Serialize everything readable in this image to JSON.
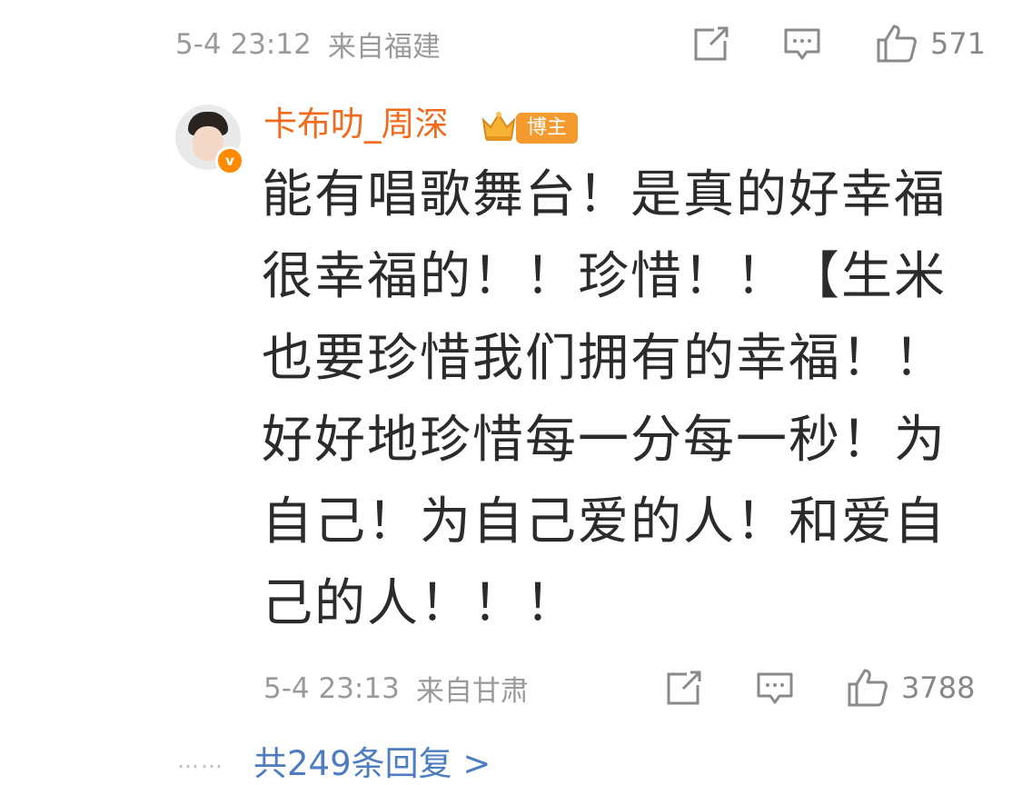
{
  "parent": {
    "time": "5-4 23:12",
    "location": "来自福建",
    "likes": "571"
  },
  "reply": {
    "username": "卡布叻_周深",
    "badge_label": "博主",
    "verified_mark": "v",
    "text": "能有唱歌舞台！是真的好幸福很幸福的！！珍惜！！【生米也要珍惜我们拥有的幸福！！好好地珍惜每一分每一秒！为自己！为自己爱的人！和爱自己的人！！！",
    "time": "5-4 23:13",
    "location": "来自甘肃",
    "likes": "3788"
  },
  "more": {
    "dots": "……",
    "label": "共249条回复 >"
  },
  "colors": {
    "username": "#f26b1d",
    "link": "#4d7cbf",
    "meta": "#9a9a9a",
    "badge": "#f59a2e"
  },
  "icons": [
    "share-icon",
    "comment-icon",
    "like-icon"
  ]
}
